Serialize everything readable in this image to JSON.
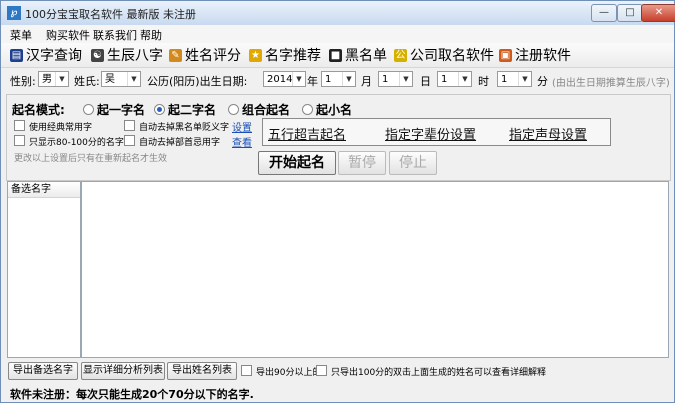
{
  "window": {
    "title": "100分宝宝取名软件 最新版 未注册",
    "app_icon": "baby-app-icon"
  },
  "menu": [
    "菜单",
    "购买软件",
    "联系我们",
    "帮助"
  ],
  "toolbar": [
    {
      "label": "汉字查询",
      "icon": "dictionary-icon",
      "color": "#1d3f8f"
    },
    {
      "label": "生辰八字",
      "icon": "yin-yang-icon",
      "color": "#444444"
    },
    {
      "label": "姓名评分",
      "icon": "edit-icon",
      "color": "#d08a1e"
    },
    {
      "label": "名字推荐",
      "icon": "star-icon",
      "color": "#e0a800"
    },
    {
      "label": "黑名单",
      "icon": "blacklist-icon",
      "color": "#222222"
    },
    {
      "label": "公司取名软件",
      "icon": "company-icon",
      "color": "#d6b000"
    },
    {
      "label": "注册软件",
      "icon": "register-icon",
      "color": "#d05a1a"
    }
  ],
  "form": {
    "gender_label": "性别:",
    "gender_value": "男",
    "surname_label": "姓氏:",
    "surname_value": "吴",
    "date_label": "公历(阳历)出生日期:",
    "year_value": "2014",
    "year_unit": "年",
    "month_value": "1",
    "month_unit": "月",
    "day_value": "1",
    "day_unit": "日",
    "hour_value": "1",
    "hour_unit": "时",
    "minute_value": "1",
    "minute_unit": "分",
    "date_hint": "(由出生日期推算生辰八字)"
  },
  "mode": {
    "label": "起名模式:",
    "options": [
      "起一字名",
      "起二字名",
      "组合起名",
      "起小名"
    ],
    "selected": "起二字名"
  },
  "options": {
    "classic": "使用经典常用字",
    "blacklist": "自动去掉黑名单贬义字",
    "blacklist_link": "设置",
    "score_range": "只显示80-100分的名字",
    "radical": "自动去掉部首忌用字",
    "radical_link": "查看",
    "hint": "更改以上设置后只有在重新起名才生效"
  },
  "framed_links": [
    "五行超吉起名",
    "指定字辈份设置",
    "指定声母设置"
  ],
  "actions": {
    "start": "开始起名",
    "pause": "暂停",
    "stop": "停止"
  },
  "list": {
    "header": "备选名字"
  },
  "bottom": {
    "export_alt": "导出备选名字",
    "show_detail": "显示详细分析列表",
    "export_name": "导出姓名列表",
    "chk_90": "导出90分以上的",
    "chk_100": "只导出100分的",
    "hint": "双击上面生成的姓名可以查看详细解释"
  },
  "status": "软件未注册：每次只能生成20个70分以下的名字."
}
